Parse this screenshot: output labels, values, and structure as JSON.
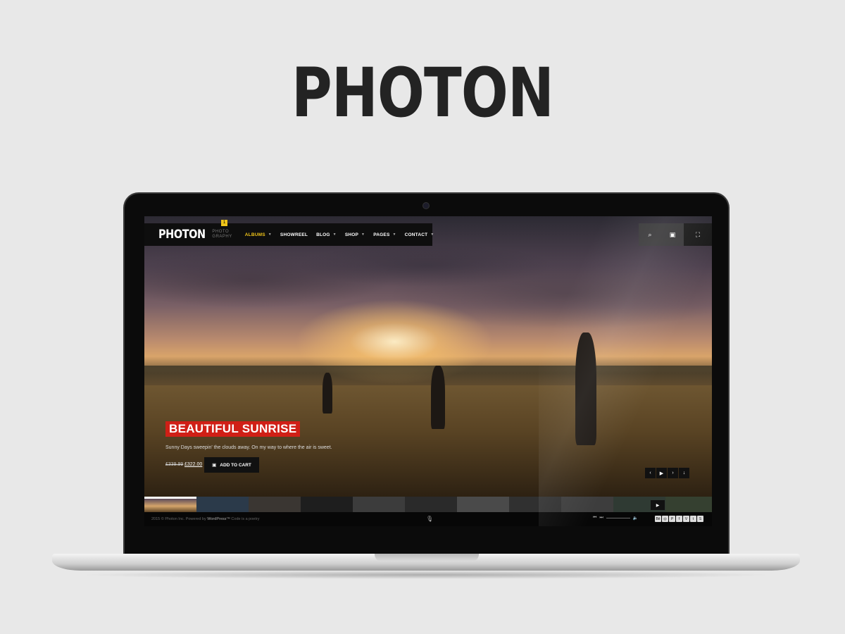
{
  "showcase": {
    "title": "PHOTON"
  },
  "site": {
    "logo": "PHOTON",
    "logo_sub": "PHOTO GRAPHY",
    "badge": "1",
    "menu": [
      {
        "label": "ALBUMS",
        "active": true,
        "has_caret": true
      },
      {
        "label": "SHOWREEL",
        "active": false,
        "has_caret": false
      },
      {
        "label": "BLOG",
        "active": false,
        "has_caret": true
      },
      {
        "label": "SHOP",
        "active": false,
        "has_caret": true
      },
      {
        "label": "PAGES",
        "active": false,
        "has_caret": true
      },
      {
        "label": "CONTACT",
        "active": false,
        "has_caret": true
      }
    ],
    "top_icons": [
      "search-icon",
      "bag-icon",
      "fullscreen-icon"
    ],
    "slide": {
      "title": "BEAUTIFUL SUNRISE",
      "description": "Sunny Days sweepin' the clouds away. On my way to where the air is sweet.",
      "price_old": "£339.99",
      "price_new": "£322.00",
      "cart_label": "ADD TO CART"
    },
    "footer": {
      "copyright": "2015 © Photon Inc. Powered by",
      "wordpress": "WordPress™",
      "tagline": "Code is a poetry"
    },
    "social": [
      "Bē",
      "◎",
      "P",
      "f",
      "V",
      "t",
      "S"
    ]
  },
  "colors": {
    "accent": "#f0c419",
    "title_bg": "#d01f16",
    "page_bg": "#e8e8e8"
  }
}
